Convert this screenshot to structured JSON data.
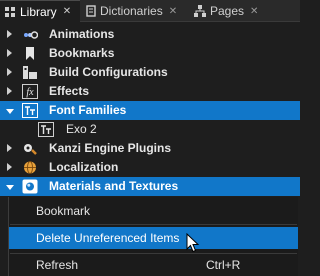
{
  "tabs": [
    {
      "label": "Library",
      "icon": "library-icon",
      "active": true
    },
    {
      "label": "Dictionaries",
      "icon": "dictionary-icon",
      "active": false
    },
    {
      "label": "Pages",
      "icon": "pages-icon",
      "active": false
    }
  ],
  "tree": {
    "items": [
      {
        "label": "Animations",
        "icon": "animations-icon",
        "expanded": false,
        "selected": false
      },
      {
        "label": "Bookmarks",
        "icon": "bookmarks-icon",
        "expanded": false,
        "selected": false
      },
      {
        "label": "Build Configurations",
        "icon": "build-configurations-icon",
        "expanded": false,
        "selected": false
      },
      {
        "label": "Effects",
        "icon": "effects-icon",
        "icon_text": "fx",
        "expanded": false,
        "selected": false
      },
      {
        "label": "Font Families",
        "icon": "font-families-icon",
        "expanded": true,
        "selected": true
      },
      {
        "label": "Exo 2",
        "icon": "font-icon",
        "child": true,
        "selected": false
      },
      {
        "label": "Kanzi Engine Plugins",
        "icon": "plugins-icon",
        "expanded": false,
        "selected": false
      },
      {
        "label": "Localization",
        "icon": "localization-icon",
        "expanded": false,
        "selected": false
      },
      {
        "label": "Materials and Textures",
        "icon": "materials-textures-icon",
        "expanded": true,
        "selected": true
      }
    ]
  },
  "context_menu": {
    "items": [
      {
        "label": "Bookmark",
        "shortcut": ""
      },
      {
        "label": "Delete Unreferenced Items",
        "shortcut": "",
        "hovered": true
      },
      {
        "label": "Refresh",
        "shortcut": "Ctrl+R"
      }
    ]
  },
  "colors": {
    "selection": "#1177c9",
    "background": "#1e1e1e",
    "tab_bar": "#2a2a2a"
  }
}
